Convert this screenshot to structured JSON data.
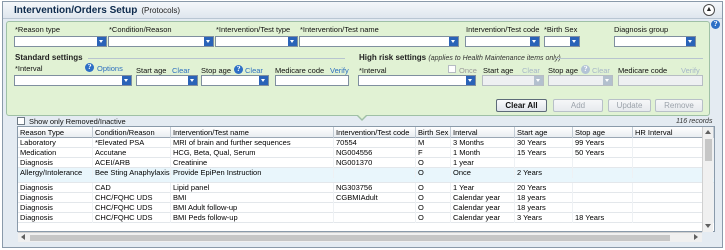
{
  "window": {
    "title": "Intervention/Orders Setup",
    "subtitle": "(Protocols)",
    "collapse_glyph": "▲"
  },
  "filters": {
    "reason_type": {
      "label": "*Reason type",
      "value": ""
    },
    "condition_reason": {
      "label": "*Condition/Reason",
      "value": ""
    },
    "intervention_type": {
      "label": "*Intervention/Test type",
      "value": ""
    },
    "intervention_name": {
      "label": "*Intervention/Test name",
      "value": ""
    },
    "intervention_code": {
      "label": "Intervention/Test code",
      "value": ""
    },
    "birth_sex": {
      "label": "*Birth Sex",
      "value": ""
    },
    "diagnosis_group": {
      "label": "Diagnosis group",
      "value": ""
    }
  },
  "standard_settings": {
    "title": "Standard settings",
    "interval_label": "*Interval",
    "options_link": "Options",
    "start_age_label": "Start age",
    "start_clear": "Clear",
    "stop_age_label": "Stop age",
    "stop_clear": "Clear",
    "medicare_label": "Medicare code",
    "verify_link": "Verify"
  },
  "high_risk_settings": {
    "title": "High risk settings",
    "note": "(applies to Health Maintenance items only)",
    "interval_label": "*Interval",
    "once_label": "Once",
    "start_age_label": "Start age",
    "start_clear": "Clear",
    "stop_age_label": "Stop age",
    "stop_clear": "Clear",
    "medicare_label": "Medicare code",
    "verify_link": "Verify"
  },
  "actions": {
    "clear_all": "Clear All",
    "add": "Add",
    "update": "Update",
    "remove": "Remove"
  },
  "show_removed_label": "Show only Removed/Inactive",
  "record_count": "116 records",
  "icons": {
    "help": "?"
  },
  "table": {
    "columns": [
      "Reason Type",
      "Condition/Reason",
      "Intervention/Test name",
      "Intervention/Test code",
      "Birth Sex",
      "Interval",
      "Start age",
      "Stop age",
      "HR Interval"
    ],
    "rows": [
      [
        "Laboratory",
        "*Elevated PSA",
        "MRI of brain and further sequences",
        "70554",
        "M",
        "3 Months",
        "30 Years",
        "99 Years",
        ""
      ],
      [
        "Medication",
        "Accutane",
        "HCG, Beta, Qual, Serum",
        "NG004556",
        "F",
        "1 Month",
        "15 Years",
        "50 Years",
        ""
      ],
      [
        "Diagnosis",
        "ACEI/ARB",
        "Creatinine",
        "NG001370",
        "O",
        "1 year",
        "",
        "",
        ""
      ],
      [
        "Allergy/Intolerance",
        "Bee Sting Anaphylaxis",
        "Provide EpiPen Instruction",
        "",
        "O",
        "Once",
        "2 Years",
        "",
        ""
      ],
      [
        "Diagnosis",
        "CAD",
        "Lipid panel",
        "NG303756",
        "O",
        "1 Year",
        "20 Years",
        "",
        ""
      ],
      [
        "Diagnosis",
        "CHC/FQHC UDS",
        "BMI",
        "CGBMIAdult",
        "O",
        "Calendar year",
        "18 years",
        "",
        ""
      ],
      [
        "Diagnosis",
        "CHC/FQHC UDS",
        "BMI Adult follow-up",
        "",
        "O",
        "Calendar year",
        "18 years",
        "",
        ""
      ],
      [
        "Diagnosis",
        "CHC/FQHC UDS",
        "BMI Peds follow-up",
        "",
        "O",
        "Calendar year",
        "3 Years",
        "18 Years",
        ""
      ]
    ]
  }
}
